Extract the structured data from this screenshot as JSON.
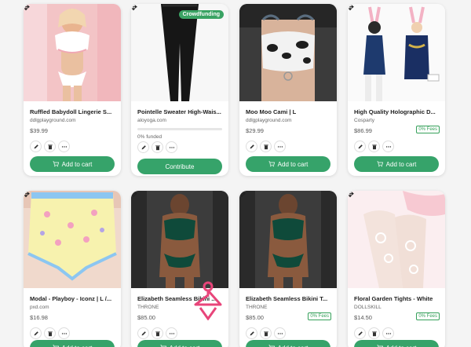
{
  "ui": {
    "cart_label": "Add to cart",
    "contribute_label": "Contribute"
  },
  "cards": [
    {
      "title": "Ruffled Babydoll Lingerie S...",
      "domain": "ddlgplayground.com",
      "price": "$39.99",
      "fees": "",
      "type": "cart"
    },
    {
      "title": "Pointelle Sweater High-Wais...",
      "domain": "aloyoga.com",
      "price": "",
      "fees": "",
      "badge": "Crowdfunding",
      "funded": "0% funded",
      "funded_fraction": 0,
      "type": "contribute"
    },
    {
      "title": "Moo Moo Cami | L",
      "domain": "ddlgplayground.com",
      "price": "$29.99",
      "fees": "",
      "type": "cart"
    },
    {
      "title": "High Quality Holographic D...",
      "domain": "Cosparty",
      "price": "$86.99",
      "fees": "0% Fees",
      "type": "cart"
    },
    {
      "title": "Modal - Playboy - Iconz | L /...",
      "domain": "pxd.com",
      "price": "$16.98",
      "fees": "",
      "type": "cart"
    },
    {
      "title": "Elizabeth Seamless Bikini ...",
      "domain": "THRONE",
      "price": "$85.00",
      "fees": "",
      "type": "cart"
    },
    {
      "title": "Elizabeth Seamless Bikini T...",
      "domain": "THRONE",
      "price": "$85.00",
      "fees": "0% Fees",
      "type": "cart"
    },
    {
      "title": "Floral Garden Tights - White",
      "domain": "DOLLSKILL",
      "price": "$14.50",
      "fees": "0% Fees",
      "type": "cart"
    }
  ],
  "icons": {
    "move": "move-icon",
    "edit": "pencil-icon",
    "delete": "trash-icon",
    "more": "more-icon",
    "cart": "cart-icon"
  },
  "colors": {
    "accent": "#36a36a",
    "badge": "#3aa363",
    "watermark": "#e8457a"
  }
}
